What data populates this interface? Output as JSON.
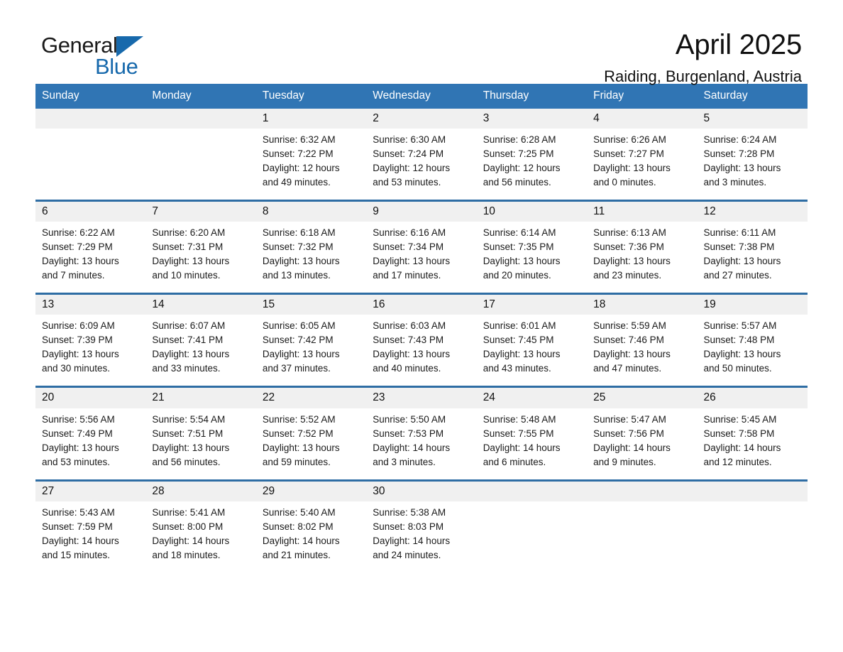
{
  "brand": {
    "name_part1": "General",
    "name_part2": "Blue",
    "accent_color": "#1769ac"
  },
  "header": {
    "month_title": "April 2025",
    "location": "Raiding, Burgenland, Austria"
  },
  "calendar": {
    "header_bg": "#3075b4",
    "row_divider_color": "#2e6da4",
    "daynum_bg": "#f0f0f0",
    "weekday_headers": [
      "Sunday",
      "Monday",
      "Tuesday",
      "Wednesday",
      "Thursday",
      "Friday",
      "Saturday"
    ],
    "weeks": [
      [
        {
          "day": "",
          "empty": true,
          "lines": []
        },
        {
          "day": "",
          "empty": true,
          "lines": []
        },
        {
          "day": "1",
          "empty": false,
          "lines": [
            "Sunrise: 6:32 AM",
            "Sunset: 7:22 PM",
            "Daylight: 12 hours",
            "and 49 minutes."
          ]
        },
        {
          "day": "2",
          "empty": false,
          "lines": [
            "Sunrise: 6:30 AM",
            "Sunset: 7:24 PM",
            "Daylight: 12 hours",
            "and 53 minutes."
          ]
        },
        {
          "day": "3",
          "empty": false,
          "lines": [
            "Sunrise: 6:28 AM",
            "Sunset: 7:25 PM",
            "Daylight: 12 hours",
            "and 56 minutes."
          ]
        },
        {
          "day": "4",
          "empty": false,
          "lines": [
            "Sunrise: 6:26 AM",
            "Sunset: 7:27 PM",
            "Daylight: 13 hours",
            "and 0 minutes."
          ]
        },
        {
          "day": "5",
          "empty": false,
          "lines": [
            "Sunrise: 6:24 AM",
            "Sunset: 7:28 PM",
            "Daylight: 13 hours",
            "and 3 minutes."
          ]
        }
      ],
      [
        {
          "day": "6",
          "empty": false,
          "lines": [
            "Sunrise: 6:22 AM",
            "Sunset: 7:29 PM",
            "Daylight: 13 hours",
            "and 7 minutes."
          ]
        },
        {
          "day": "7",
          "empty": false,
          "lines": [
            "Sunrise: 6:20 AM",
            "Sunset: 7:31 PM",
            "Daylight: 13 hours",
            "and 10 minutes."
          ]
        },
        {
          "day": "8",
          "empty": false,
          "lines": [
            "Sunrise: 6:18 AM",
            "Sunset: 7:32 PM",
            "Daylight: 13 hours",
            "and 13 minutes."
          ]
        },
        {
          "day": "9",
          "empty": false,
          "lines": [
            "Sunrise: 6:16 AM",
            "Sunset: 7:34 PM",
            "Daylight: 13 hours",
            "and 17 minutes."
          ]
        },
        {
          "day": "10",
          "empty": false,
          "lines": [
            "Sunrise: 6:14 AM",
            "Sunset: 7:35 PM",
            "Daylight: 13 hours",
            "and 20 minutes."
          ]
        },
        {
          "day": "11",
          "empty": false,
          "lines": [
            "Sunrise: 6:13 AM",
            "Sunset: 7:36 PM",
            "Daylight: 13 hours",
            "and 23 minutes."
          ]
        },
        {
          "day": "12",
          "empty": false,
          "lines": [
            "Sunrise: 6:11 AM",
            "Sunset: 7:38 PM",
            "Daylight: 13 hours",
            "and 27 minutes."
          ]
        }
      ],
      [
        {
          "day": "13",
          "empty": false,
          "lines": [
            "Sunrise: 6:09 AM",
            "Sunset: 7:39 PM",
            "Daylight: 13 hours",
            "and 30 minutes."
          ]
        },
        {
          "day": "14",
          "empty": false,
          "lines": [
            "Sunrise: 6:07 AM",
            "Sunset: 7:41 PM",
            "Daylight: 13 hours",
            "and 33 minutes."
          ]
        },
        {
          "day": "15",
          "empty": false,
          "lines": [
            "Sunrise: 6:05 AM",
            "Sunset: 7:42 PM",
            "Daylight: 13 hours",
            "and 37 minutes."
          ]
        },
        {
          "day": "16",
          "empty": false,
          "lines": [
            "Sunrise: 6:03 AM",
            "Sunset: 7:43 PM",
            "Daylight: 13 hours",
            "and 40 minutes."
          ]
        },
        {
          "day": "17",
          "empty": false,
          "lines": [
            "Sunrise: 6:01 AM",
            "Sunset: 7:45 PM",
            "Daylight: 13 hours",
            "and 43 minutes."
          ]
        },
        {
          "day": "18",
          "empty": false,
          "lines": [
            "Sunrise: 5:59 AM",
            "Sunset: 7:46 PM",
            "Daylight: 13 hours",
            "and 47 minutes."
          ]
        },
        {
          "day": "19",
          "empty": false,
          "lines": [
            "Sunrise: 5:57 AM",
            "Sunset: 7:48 PM",
            "Daylight: 13 hours",
            "and 50 minutes."
          ]
        }
      ],
      [
        {
          "day": "20",
          "empty": false,
          "lines": [
            "Sunrise: 5:56 AM",
            "Sunset: 7:49 PM",
            "Daylight: 13 hours",
            "and 53 minutes."
          ]
        },
        {
          "day": "21",
          "empty": false,
          "lines": [
            "Sunrise: 5:54 AM",
            "Sunset: 7:51 PM",
            "Daylight: 13 hours",
            "and 56 minutes."
          ]
        },
        {
          "day": "22",
          "empty": false,
          "lines": [
            "Sunrise: 5:52 AM",
            "Sunset: 7:52 PM",
            "Daylight: 13 hours",
            "and 59 minutes."
          ]
        },
        {
          "day": "23",
          "empty": false,
          "lines": [
            "Sunrise: 5:50 AM",
            "Sunset: 7:53 PM",
            "Daylight: 14 hours",
            "and 3 minutes."
          ]
        },
        {
          "day": "24",
          "empty": false,
          "lines": [
            "Sunrise: 5:48 AM",
            "Sunset: 7:55 PM",
            "Daylight: 14 hours",
            "and 6 minutes."
          ]
        },
        {
          "day": "25",
          "empty": false,
          "lines": [
            "Sunrise: 5:47 AM",
            "Sunset: 7:56 PM",
            "Daylight: 14 hours",
            "and 9 minutes."
          ]
        },
        {
          "day": "26",
          "empty": false,
          "lines": [
            "Sunrise: 5:45 AM",
            "Sunset: 7:58 PM",
            "Daylight: 14 hours",
            "and 12 minutes."
          ]
        }
      ],
      [
        {
          "day": "27",
          "empty": false,
          "lines": [
            "Sunrise: 5:43 AM",
            "Sunset: 7:59 PM",
            "Daylight: 14 hours",
            "and 15 minutes."
          ]
        },
        {
          "day": "28",
          "empty": false,
          "lines": [
            "Sunrise: 5:41 AM",
            "Sunset: 8:00 PM",
            "Daylight: 14 hours",
            "and 18 minutes."
          ]
        },
        {
          "day": "29",
          "empty": false,
          "lines": [
            "Sunrise: 5:40 AM",
            "Sunset: 8:02 PM",
            "Daylight: 14 hours",
            "and 21 minutes."
          ]
        },
        {
          "day": "30",
          "empty": false,
          "lines": [
            "Sunrise: 5:38 AM",
            "Sunset: 8:03 PM",
            "Daylight: 14 hours",
            "and 24 minutes."
          ]
        },
        {
          "day": "",
          "empty": true,
          "lines": []
        },
        {
          "day": "",
          "empty": true,
          "lines": []
        },
        {
          "day": "",
          "empty": true,
          "lines": []
        }
      ]
    ]
  }
}
